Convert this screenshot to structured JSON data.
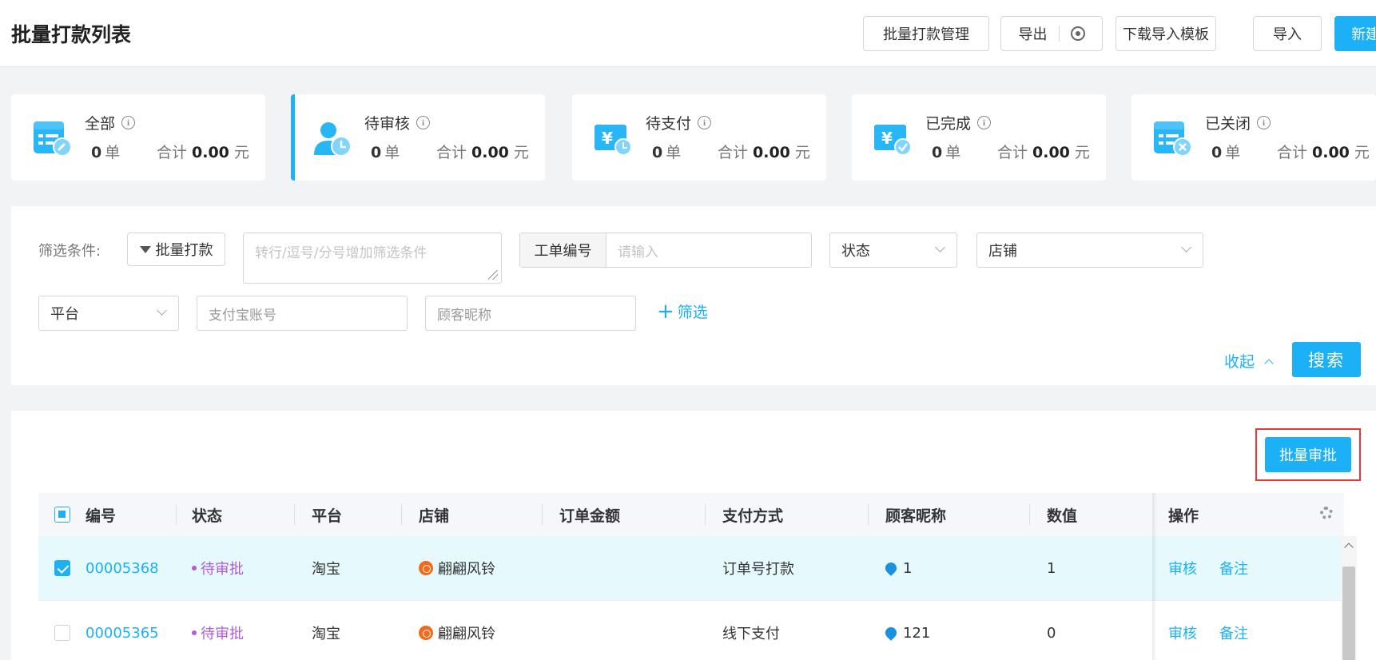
{
  "header": {
    "title": "批量打款列表",
    "buttons": {
      "batch_manage": "批量打款管理",
      "export": "导出",
      "download_template": "下载导入模板",
      "import": "导入",
      "new": "新建"
    }
  },
  "stats": [
    {
      "label": "全部",
      "count": "0",
      "count_unit": "单",
      "sum_label": "合计",
      "sum": "0.00",
      "sum_unit": "元",
      "icon": "all-orders-icon"
    },
    {
      "label": "待审核",
      "count": "0",
      "count_unit": "单",
      "sum_label": "合计",
      "sum": "0.00",
      "sum_unit": "元",
      "icon": "pending-review-icon"
    },
    {
      "label": "待支付",
      "count": "0",
      "count_unit": "单",
      "sum_label": "合计",
      "sum": "0.00",
      "sum_unit": "元",
      "icon": "pending-payment-icon"
    },
    {
      "label": "已完成",
      "count": "0",
      "count_unit": "单",
      "sum_label": "合计",
      "sum": "0.00",
      "sum_unit": "元",
      "icon": "completed-icon"
    },
    {
      "label": "已关闭",
      "count": "0",
      "count_unit": "单",
      "sum_label": "合计",
      "sum": "0.00",
      "sum_unit": "元",
      "icon": "closed-icon"
    }
  ],
  "filter": {
    "label": "筛选条件:",
    "tag": "批量打款",
    "textarea_placeholder": "转行/逗号/分号增加筛选条件",
    "order_no_label": "工单编号",
    "order_no_placeholder": "请输入",
    "status_select": "状态",
    "shop_select": "店铺",
    "platform_select": "平台",
    "alipay_placeholder": "支付宝账号",
    "nickname_placeholder": "顾客昵称",
    "add_filter": "筛选",
    "collapse": "收起",
    "search": "搜索"
  },
  "table": {
    "batch_approve": "批量审批",
    "columns": [
      "编号",
      "状态",
      "平台",
      "店铺",
      "订单金额",
      "支付方式",
      "顾客昵称",
      "数值",
      "操作"
    ],
    "rows": [
      {
        "id": "00005368",
        "status": "待审批",
        "platform": "淘宝",
        "shop": "翩翩风铃",
        "amount": "",
        "payment": "订单号打款",
        "nickname": "1",
        "value": "1",
        "actions": [
          "审核",
          "备注"
        ],
        "selected": true
      },
      {
        "id": "00005365",
        "status": "待审批",
        "platform": "淘宝",
        "shop": "翩翩风铃",
        "amount": "",
        "payment": "线下支付",
        "nickname": "121",
        "value": "0",
        "actions": [
          "审核",
          "备注"
        ],
        "selected": false
      }
    ]
  },
  "colors": {
    "accent": "#1cb0f6",
    "status_pending": "#b15bd9",
    "highlight": "#e53935"
  }
}
